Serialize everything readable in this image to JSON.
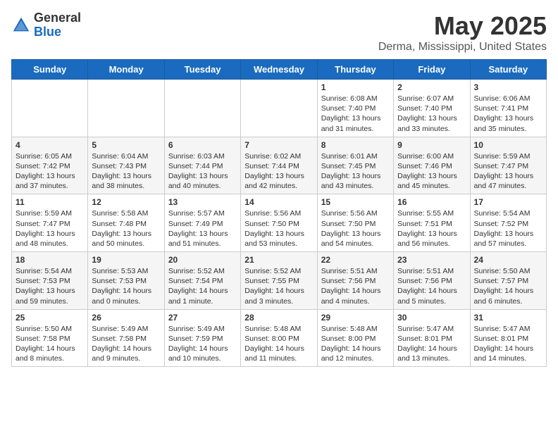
{
  "header": {
    "logo_general": "General",
    "logo_blue": "Blue",
    "title": "May 2025",
    "location": "Derma, Mississippi, United States"
  },
  "days_of_week": [
    "Sunday",
    "Monday",
    "Tuesday",
    "Wednesday",
    "Thursday",
    "Friday",
    "Saturday"
  ],
  "weeks": [
    [
      {
        "day": "",
        "info": ""
      },
      {
        "day": "",
        "info": ""
      },
      {
        "day": "",
        "info": ""
      },
      {
        "day": "",
        "info": ""
      },
      {
        "day": "1",
        "info": "Sunrise: 6:08 AM\nSunset: 7:40 PM\nDaylight: 13 hours\nand 31 minutes."
      },
      {
        "day": "2",
        "info": "Sunrise: 6:07 AM\nSunset: 7:40 PM\nDaylight: 13 hours\nand 33 minutes."
      },
      {
        "day": "3",
        "info": "Sunrise: 6:06 AM\nSunset: 7:41 PM\nDaylight: 13 hours\nand 35 minutes."
      }
    ],
    [
      {
        "day": "4",
        "info": "Sunrise: 6:05 AM\nSunset: 7:42 PM\nDaylight: 13 hours\nand 37 minutes."
      },
      {
        "day": "5",
        "info": "Sunrise: 6:04 AM\nSunset: 7:43 PM\nDaylight: 13 hours\nand 38 minutes."
      },
      {
        "day": "6",
        "info": "Sunrise: 6:03 AM\nSunset: 7:44 PM\nDaylight: 13 hours\nand 40 minutes."
      },
      {
        "day": "7",
        "info": "Sunrise: 6:02 AM\nSunset: 7:44 PM\nDaylight: 13 hours\nand 42 minutes."
      },
      {
        "day": "8",
        "info": "Sunrise: 6:01 AM\nSunset: 7:45 PM\nDaylight: 13 hours\nand 43 minutes."
      },
      {
        "day": "9",
        "info": "Sunrise: 6:00 AM\nSunset: 7:46 PM\nDaylight: 13 hours\nand 45 minutes."
      },
      {
        "day": "10",
        "info": "Sunrise: 5:59 AM\nSunset: 7:47 PM\nDaylight: 13 hours\nand 47 minutes."
      }
    ],
    [
      {
        "day": "11",
        "info": "Sunrise: 5:59 AM\nSunset: 7:47 PM\nDaylight: 13 hours\nand 48 minutes."
      },
      {
        "day": "12",
        "info": "Sunrise: 5:58 AM\nSunset: 7:48 PM\nDaylight: 13 hours\nand 50 minutes."
      },
      {
        "day": "13",
        "info": "Sunrise: 5:57 AM\nSunset: 7:49 PM\nDaylight: 13 hours\nand 51 minutes."
      },
      {
        "day": "14",
        "info": "Sunrise: 5:56 AM\nSunset: 7:50 PM\nDaylight: 13 hours\nand 53 minutes."
      },
      {
        "day": "15",
        "info": "Sunrise: 5:56 AM\nSunset: 7:50 PM\nDaylight: 13 hours\nand 54 minutes."
      },
      {
        "day": "16",
        "info": "Sunrise: 5:55 AM\nSunset: 7:51 PM\nDaylight: 13 hours\nand 56 minutes."
      },
      {
        "day": "17",
        "info": "Sunrise: 5:54 AM\nSunset: 7:52 PM\nDaylight: 13 hours\nand 57 minutes."
      }
    ],
    [
      {
        "day": "18",
        "info": "Sunrise: 5:54 AM\nSunset: 7:53 PM\nDaylight: 13 hours\nand 59 minutes."
      },
      {
        "day": "19",
        "info": "Sunrise: 5:53 AM\nSunset: 7:53 PM\nDaylight: 14 hours\nand 0 minutes."
      },
      {
        "day": "20",
        "info": "Sunrise: 5:52 AM\nSunset: 7:54 PM\nDaylight: 14 hours\nand 1 minute."
      },
      {
        "day": "21",
        "info": "Sunrise: 5:52 AM\nSunset: 7:55 PM\nDaylight: 14 hours\nand 3 minutes."
      },
      {
        "day": "22",
        "info": "Sunrise: 5:51 AM\nSunset: 7:56 PM\nDaylight: 14 hours\nand 4 minutes."
      },
      {
        "day": "23",
        "info": "Sunrise: 5:51 AM\nSunset: 7:56 PM\nDaylight: 14 hours\nand 5 minutes."
      },
      {
        "day": "24",
        "info": "Sunrise: 5:50 AM\nSunset: 7:57 PM\nDaylight: 14 hours\nand 6 minutes."
      }
    ],
    [
      {
        "day": "25",
        "info": "Sunrise: 5:50 AM\nSunset: 7:58 PM\nDaylight: 14 hours\nand 8 minutes."
      },
      {
        "day": "26",
        "info": "Sunrise: 5:49 AM\nSunset: 7:58 PM\nDaylight: 14 hours\nand 9 minutes."
      },
      {
        "day": "27",
        "info": "Sunrise: 5:49 AM\nSunset: 7:59 PM\nDaylight: 14 hours\nand 10 minutes."
      },
      {
        "day": "28",
        "info": "Sunrise: 5:48 AM\nSunset: 8:00 PM\nDaylight: 14 hours\nand 11 minutes."
      },
      {
        "day": "29",
        "info": "Sunrise: 5:48 AM\nSunset: 8:00 PM\nDaylight: 14 hours\nand 12 minutes."
      },
      {
        "day": "30",
        "info": "Sunrise: 5:47 AM\nSunset: 8:01 PM\nDaylight: 14 hours\nand 13 minutes."
      },
      {
        "day": "31",
        "info": "Sunrise: 5:47 AM\nSunset: 8:01 PM\nDaylight: 14 hours\nand 14 minutes."
      }
    ]
  ]
}
